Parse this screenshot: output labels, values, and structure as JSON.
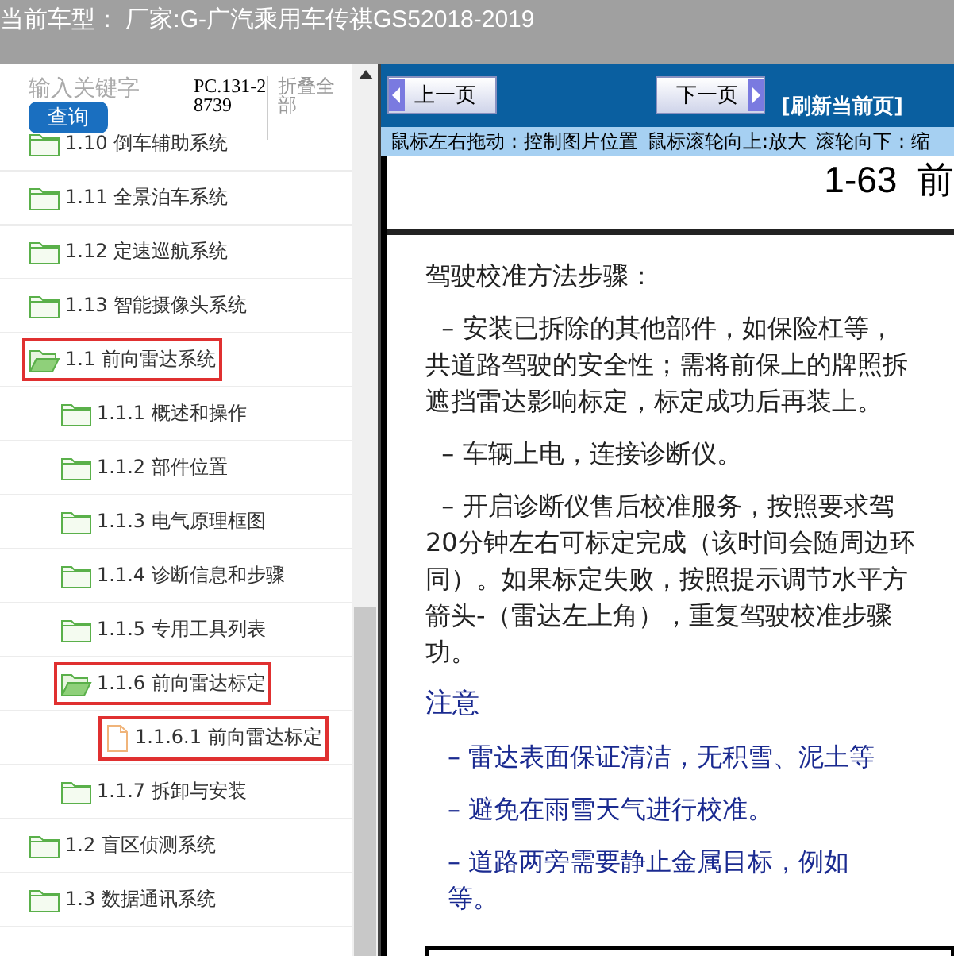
{
  "header": {
    "title": "当前车型： 厂家:G-广汽乘用车传祺GS52018-2019"
  },
  "search": {
    "placeholder": "输入关键字",
    "button": "查询",
    "code": "PC.131-28739",
    "collapse_link": "折叠全部"
  },
  "tree": [
    {
      "label": "1.10 倒车辅助系统",
      "kind": "folder",
      "expanded": false,
      "highlighted": false
    },
    {
      "label": "1.11 全景泊车系统",
      "kind": "folder",
      "expanded": false,
      "highlighted": false
    },
    {
      "label": "1.12 定速巡航系统",
      "kind": "folder",
      "expanded": false,
      "highlighted": false
    },
    {
      "label": "1.13 智能摄像头系统",
      "kind": "folder",
      "expanded": false,
      "highlighted": false
    },
    {
      "label": "1.1 前向雷达系统",
      "kind": "folder",
      "expanded": true,
      "highlighted": true,
      "children": [
        {
          "label": "1.1.1 概述和操作",
          "kind": "folder",
          "expanded": false,
          "highlighted": false
        },
        {
          "label": "1.1.2 部件位置",
          "kind": "folder",
          "expanded": false,
          "highlighted": false
        },
        {
          "label": "1.1.3 电气原理框图",
          "kind": "folder",
          "expanded": false,
          "highlighted": false
        },
        {
          "label": "1.1.4 诊断信息和步骤",
          "kind": "folder",
          "expanded": false,
          "highlighted": false
        },
        {
          "label": "1.1.5 专用工具列表",
          "kind": "folder",
          "expanded": false,
          "highlighted": false
        },
        {
          "label": "1.1.6 前向雷达标定",
          "kind": "folder",
          "expanded": true,
          "highlighted": true,
          "children": [
            {
              "label": "1.1.6.1 前向雷达标定",
              "kind": "page",
              "highlighted": true
            }
          ]
        },
        {
          "label": "1.1.7 拆卸与安装",
          "kind": "folder",
          "expanded": false,
          "highlighted": false
        }
      ]
    },
    {
      "label": "1.2 盲区侦测系统",
      "kind": "folder",
      "expanded": false,
      "highlighted": false
    },
    {
      "label": "1.3 数据通讯系统",
      "kind": "folder",
      "expanded": false,
      "highlighted": false
    }
  ],
  "toolbar": {
    "prev": "上一页",
    "next": "下一页",
    "refresh": "[刷新当前页]"
  },
  "hints": [
    "鼠标左右拖动：控制图片位置",
    "鼠标滚轮向上:放大",
    "滚轮向下：缩"
  ],
  "document": {
    "page_heading": "1-63  前",
    "blocks": [
      {
        "kind": "text",
        "lines": [
          "驾驶校准方法步骤："
        ]
      },
      {
        "kind": "text",
        "lines": [
          "  – 安装已拆除的其他部件，如保险杠等，",
          "共道路驾驶的安全性；需将前保上的牌照拆",
          "遮挡雷达影响标定，标定成功后再装上。"
        ]
      },
      {
        "kind": "text",
        "lines": [
          "  – 车辆上电，连接诊断仪。"
        ]
      },
      {
        "kind": "text",
        "lines": [
          "  – 开启诊断仪售后校准服务，按照要求驾",
          "20分钟左右可标定完成（该时间会随周边环",
          "同）。如果标定失败，按照提示调节水平方",
          "箭头-（雷达左上角），重复驾驶校准步骤",
          "功。"
        ]
      },
      {
        "kind": "heading",
        "lines": [
          "注意"
        ]
      },
      {
        "kind": "note",
        "lines": [
          "– 雷达表面保证清洁，无积雪、泥土等"
        ]
      },
      {
        "kind": "note",
        "lines": [
          "– 避免在雨雪天气进行校准。"
        ]
      },
      {
        "kind": "note",
        "lines": [
          "– 道路两旁需要静止金属目标，例如",
          "等。"
        ]
      }
    ]
  }
}
